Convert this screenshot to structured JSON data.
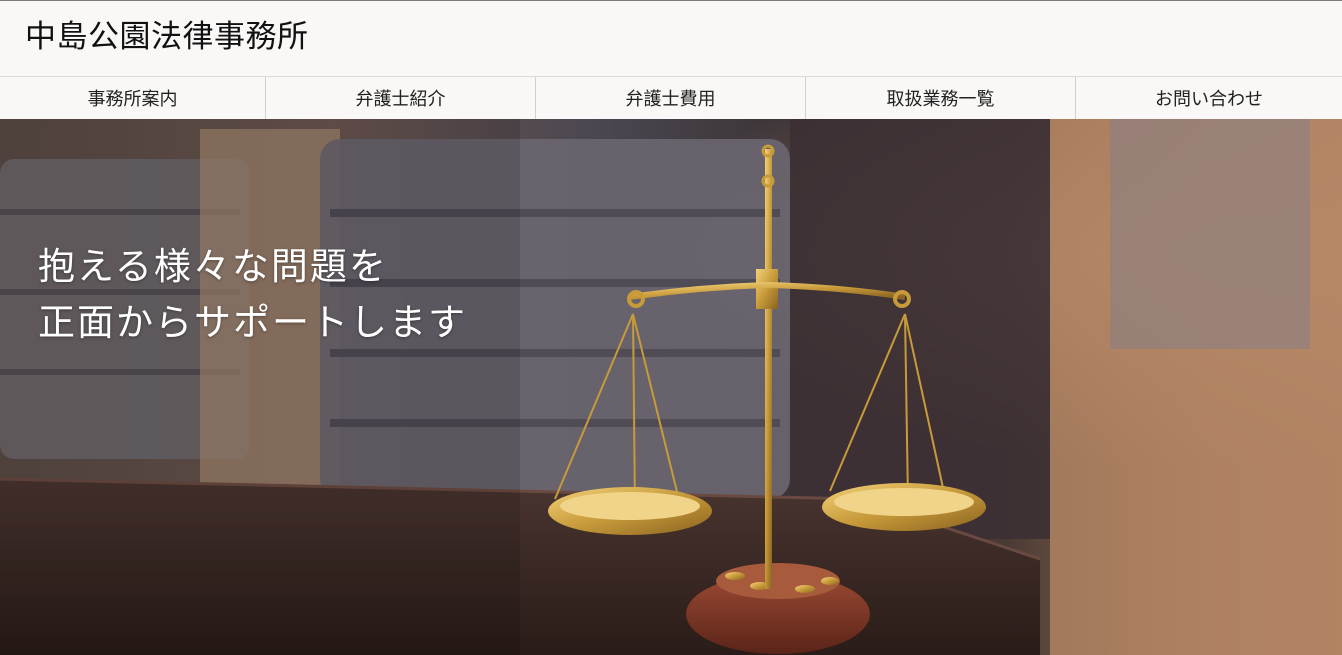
{
  "site": {
    "title": "中島公園法律事務所"
  },
  "nav": {
    "items": [
      {
        "label": "事務所案内"
      },
      {
        "label": "弁護士紹介"
      },
      {
        "label": "弁護士費用"
      },
      {
        "label": "取扱業務一覧"
      },
      {
        "label": "お問い合わせ"
      }
    ]
  },
  "hero": {
    "line1": "抱える様々な問題を",
    "line2": "正面からサポートします"
  }
}
